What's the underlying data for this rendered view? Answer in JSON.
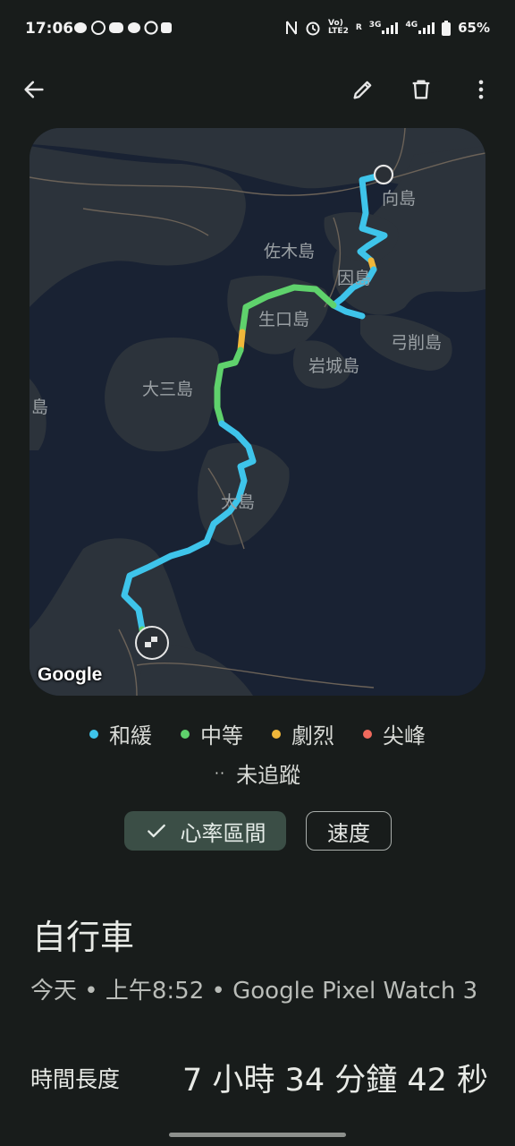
{
  "status_bar": {
    "time": "17:06",
    "left_icons": [
      "chat-bubble-icon",
      "rider-icon",
      "line-icon",
      "message-icon",
      "threads-icon",
      "bus-icon"
    ],
    "right_indicators": {
      "volte_top": "Vo)",
      "volte_bottom": "LTE2",
      "roaming": "R",
      "net1": "3G",
      "net2": "4G"
    },
    "battery": "65%"
  },
  "app_bar": {
    "back_icon": "arrow-left-icon",
    "actions": [
      "edit-icon",
      "delete-icon",
      "more-vert-icon"
    ]
  },
  "map": {
    "labels": {
      "mukaishima": "向島",
      "sagishima": "佐木島",
      "innoshima": "因島",
      "ikuchijima": "生口島",
      "yugeshima": "弓削島",
      "iwagijima": "岩城島",
      "omishima": "大三島",
      "oshima": "大島",
      "left_edge": "島"
    },
    "google_logo": "Google",
    "colors": {
      "moderate": "#3ec4ea",
      "medium": "#5fd26c",
      "intense": "#f0b73a",
      "peak": "#ef6a5d"
    }
  },
  "legend": {
    "items": [
      {
        "label": "和緩",
        "color": "#3ec4ea"
      },
      {
        "label": "中等",
        "color": "#5fd26c"
      },
      {
        "label": "劇烈",
        "color": "#f0b73a"
      },
      {
        "label": "尖峰",
        "color": "#ef6a5d"
      }
    ],
    "untracked_label": "未追蹤"
  },
  "chips": {
    "heart_rate": "心率區間",
    "speed": "速度"
  },
  "activity": {
    "title": "自行車",
    "meta": "今天 • 上午8:52 • Google Pixel Watch 3"
  },
  "stats": {
    "duration_label": "時間長度",
    "duration_value": "7 小時 34 分鐘 42 秒"
  }
}
